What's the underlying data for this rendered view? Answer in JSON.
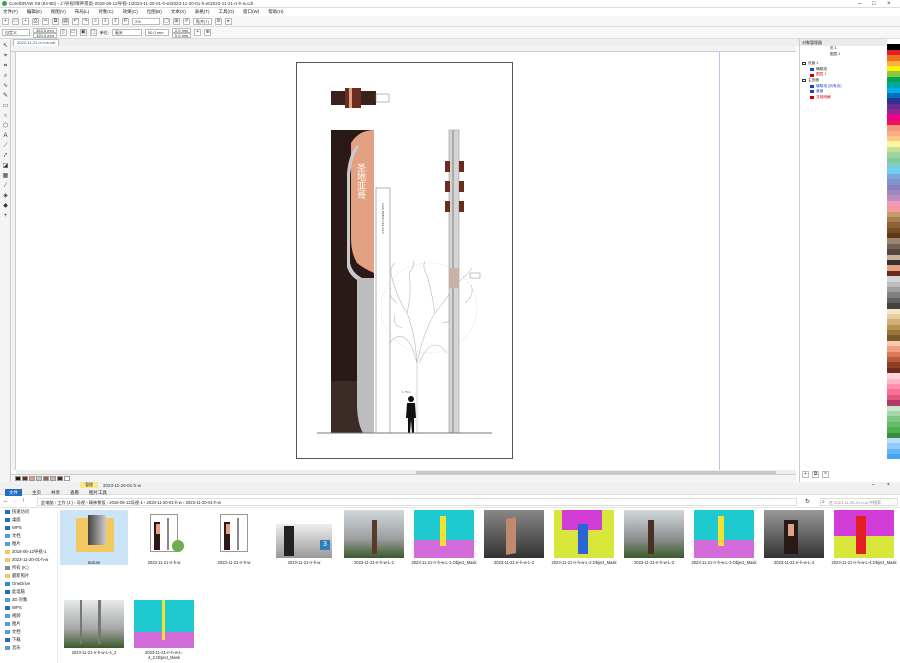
{
  "app": {
    "title": "CorelDRAW X8 (64-Bit) - J:\\导视\\晴神景饭-2018-06-12导视-1\\2023-11-20-01-h-w\\2023-11-20-01-h-w\\2023-11-21-rr-h-w.cdr",
    "doc_tab": "2023-11-21-rr-h-w.cdr"
  },
  "menu": [
    "文件(F)",
    "编辑(E)",
    "视图(V)",
    "布局(L)",
    "对象(C)",
    "效果(C)",
    "位图(B)",
    "文本(X)",
    "表格(T)",
    "工具(O)",
    "窗口(W)",
    "帮助(H)"
  ],
  "toolbar": {
    "zoom": "2%",
    "snap": "贴齐(T)",
    "paper": "自定义"
  },
  "props": {
    "width": "463.5 mm",
    "height": "120.0 mm",
    "units_label": "单位:",
    "units": "毫米",
    "nudge": "50.0 mm",
    "dup_x": "0.0 mm",
    "dup_y": "0.0 mm"
  },
  "objmgr": {
    "title": "对象管理器",
    "page_label": "页 1",
    "layer_label": "图层 1",
    "rows": [
      {
        "label": "页面 1",
        "color": "#000"
      },
      {
        "label": "辅助线",
        "color": "#1a3fd1"
      },
      {
        "label": "图层 1",
        "color": "#cc0000"
      },
      {
        "label": "主页面",
        "color": "#000"
      },
      {
        "label": "辅助线 (所有页)",
        "color": "#1a3fd1"
      },
      {
        "label": "桌面",
        "color": "#1a3fd1"
      },
      {
        "label": "文档网格",
        "color": "#cc0000"
      }
    ]
  },
  "canvas": {
    "sign_text_vertical": "SAN DIEGO PLAZA",
    "sign_chinese": "圣地亚哥",
    "scale_note": "1.75m"
  },
  "explorer": {
    "title": "2023-11-20-01-h-w",
    "manage": "管理",
    "ribbon": [
      "文件",
      "主页",
      "共享",
      "查看",
      "图片工具"
    ],
    "breadcrumb": [
      "此电脑",
      "工作 (J:)",
      "导视",
      "晴神景饭",
      "2018-06-12导视-1",
      "2023-11-20-01-h-w",
      "2023-11-20-01-h-w"
    ],
    "search_placeholder": "在 2023-11-20-01-h-w 中搜索",
    "nav": [
      "快速访问",
      "桌面",
      "WPS",
      "文档",
      "图片",
      "2018-06-12导视-1",
      "2023-11-20-01-h-w",
      "所有 (K:)",
      "最新照片",
      "OneDrive",
      "此电脑",
      "3D 对象",
      "WPS",
      "视频",
      "图片",
      "文档",
      "下载",
      "音乐"
    ],
    "files": [
      "texture",
      "2023-11-21-rr-h-w",
      "2023-11-21-rr-h-w",
      "2023-11-21-rr-h-w",
      "2023-11-21-rr-h-w-L-1",
      "2023-11-21-rr-h-w-L-1.Object_Mask",
      "2023-11-21-rr-h-w-L-2",
      "2023-11-21-rr-h-w-L-2.Object_Mask",
      "2023-11-21-rr-h-w-L-3",
      "2023-11-21-rr-h-w-L-3.Object_Mask",
      "2023-11-21-rr-h-w-L-4",
      "2023-11-21-rr-h-w-L-4.Object_Mask",
      "2023-11-21-rr-h-w-L-4_2",
      "2023-11-21-rr-h-w-L-4_2.Object_Mask"
    ]
  },
  "colors": {
    "accent": "#1f6cc1",
    "sign_dark": "#2a1a17",
    "sign_peach": "#e3a183",
    "pole_brown": "#6a2c20"
  }
}
